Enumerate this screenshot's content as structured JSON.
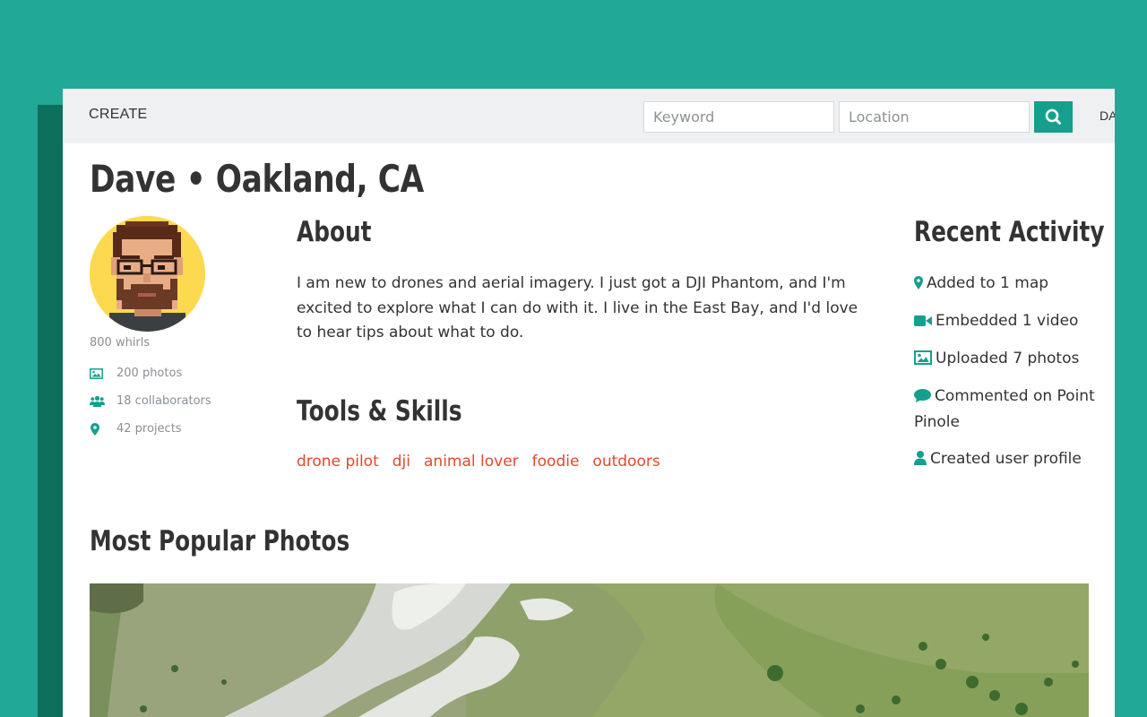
{
  "nav": {
    "create_label": "CREATE",
    "keyword_placeholder": "Keyword",
    "location_placeholder": "Location",
    "user_label": "DA"
  },
  "profile": {
    "title": "Dave • Oakland, CA",
    "whirls": "800 whirls",
    "stats": [
      {
        "icon": "image-icon",
        "label": "200 photos"
      },
      {
        "icon": "users-icon",
        "label": "18 collaborators"
      },
      {
        "icon": "map-marker-icon",
        "label": "42 projects"
      }
    ]
  },
  "about": {
    "heading": "About",
    "text": "I am new to drones and aerial imagery. I just got a DJI Phantom, and I'm excited to explore what I can do with it. I live in the East Bay, and I'd love to hear tips about what to do."
  },
  "skills": {
    "heading": "Tools & Skills",
    "tags": [
      "drone pilot",
      "dji",
      "animal lover",
      "foodie",
      "outdoors"
    ]
  },
  "activity": {
    "heading": "Recent Activity",
    "items": [
      {
        "icon": "map-marker-icon",
        "label": "Added to 1 map"
      },
      {
        "icon": "video-camera-icon",
        "label": "Embedded 1 video"
      },
      {
        "icon": "image-icon",
        "label": "Uploaded 7 photos"
      },
      {
        "icon": "comment-icon",
        "label": "Commented on Point Pinole"
      },
      {
        "icon": "user-icon",
        "label": "Created user profile"
      }
    ]
  },
  "photos": {
    "heading": "Most Popular Photos"
  },
  "colors": {
    "background": "#22a897",
    "accent": "#14a08d",
    "tag": "#e5472d",
    "text": "#333333"
  }
}
